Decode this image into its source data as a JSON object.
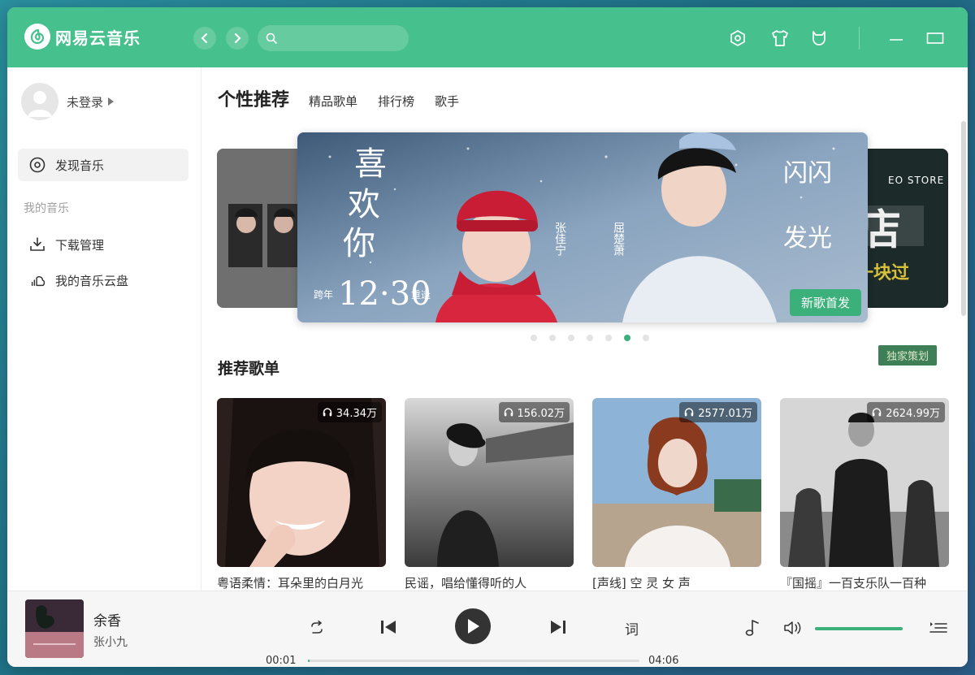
{
  "app": {
    "name": "网易云音乐",
    "brand_color": "#46c08c",
    "accent_color": "#3bb07a"
  },
  "search": {
    "value": "",
    "placeholder": ""
  },
  "sidebar": {
    "user": {
      "name": "未登录"
    },
    "items": [
      {
        "label": "发现音乐",
        "icon": "disc-icon",
        "active": true
      }
    ],
    "section_title": "我的音乐",
    "my_music": [
      {
        "label": "下载管理",
        "icon": "download-icon"
      },
      {
        "label": "我的音乐云盘",
        "icon": "cloud-icon"
      }
    ]
  },
  "main": {
    "tabs": [
      {
        "label": "个性推荐",
        "active": true
      },
      {
        "label": "精品歌单"
      },
      {
        "label": "排行榜"
      },
      {
        "label": "歌手"
      }
    ],
    "banner": {
      "badge": "新歌首发",
      "right_caption": "EO STORE",
      "right_tag": "独家策划",
      "active_dot_index": 5,
      "dot_count": 7
    },
    "recommend_title": "推荐歌单",
    "playlists": [
      {
        "title": "粤语柔情：耳朵里的白月光",
        "plays": "34.34万"
      },
      {
        "title": "民谣，唱给懂得听的人",
        "plays": "156.02万"
      },
      {
        "title": "[声线] 空 灵 女 声",
        "plays": "2577.01万"
      },
      {
        "title": "『国摇』一百支乐队一百种",
        "plays": "2624.99万"
      }
    ]
  },
  "player": {
    "song": "余香",
    "artist": "张小九",
    "current_time": "00:01",
    "duration": "04:06",
    "progress": 0.004,
    "volume": 1.0,
    "lyric_label": "词"
  }
}
